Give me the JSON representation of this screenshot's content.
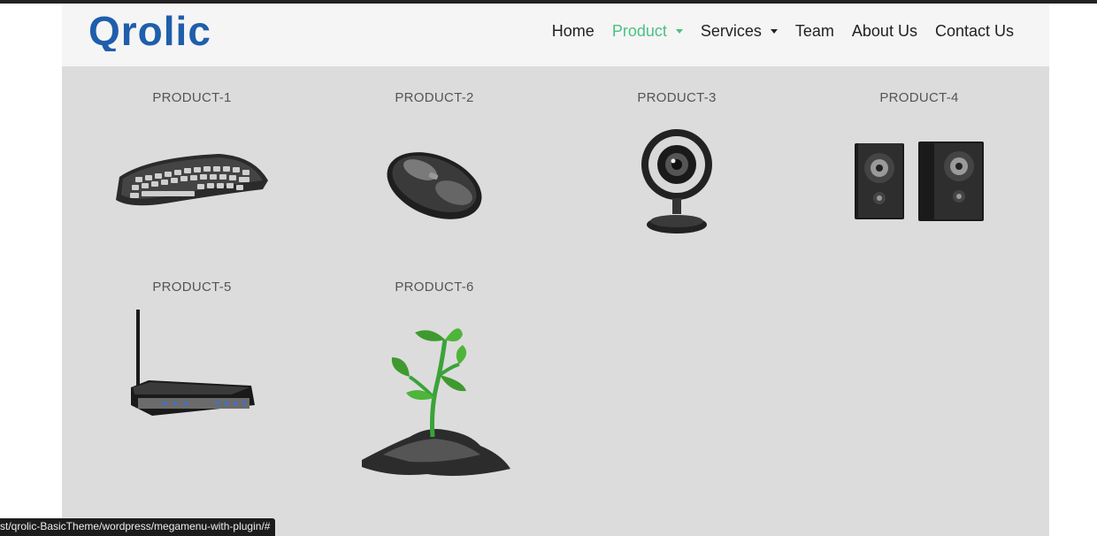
{
  "brand": {
    "logo_text": "Qrolic",
    "logo_color": "#1e5eab"
  },
  "nav": {
    "items": [
      {
        "label": "Home"
      },
      {
        "label": "Product"
      },
      {
        "label": "Services"
      },
      {
        "label": "Team"
      },
      {
        "label": "About Us"
      },
      {
        "label": "Contact Us"
      }
    ],
    "active_color": "#4cc083"
  },
  "products": [
    {
      "label": "PRODUCT-1",
      "icon": "keyboard-icon"
    },
    {
      "label": "PRODUCT-2",
      "icon": "mouse-icon"
    },
    {
      "label": "PRODUCT-3",
      "icon": "webcam-icon"
    },
    {
      "label": "PRODUCT-4",
      "icon": "speakers-icon"
    },
    {
      "label": "PRODUCT-5",
      "icon": "router-icon"
    },
    {
      "label": "PRODUCT-6",
      "icon": "plant-icon"
    }
  ],
  "status_bar": {
    "url": "st/qrolic-BasicTheme/wordpress/megamenu-with-plugin/#"
  }
}
